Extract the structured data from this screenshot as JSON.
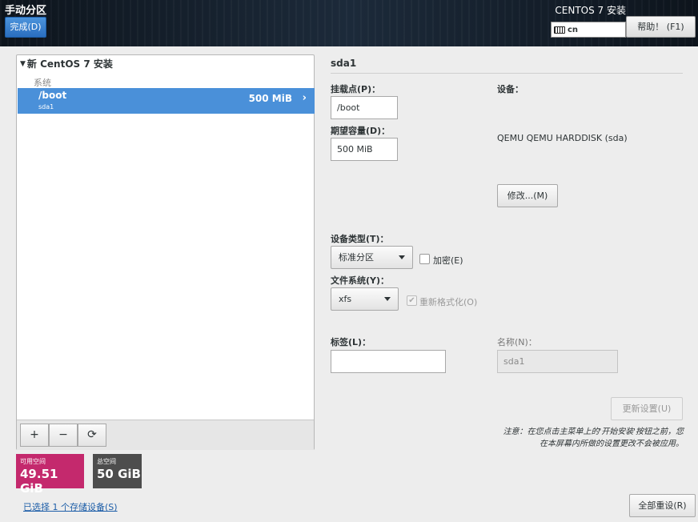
{
  "header": {
    "title": "手动分区",
    "done_label": "完成(D)",
    "product": "CENTOS 7 安装",
    "keyboard_layout": "cn",
    "help_label": "帮助！ (F1)"
  },
  "partitions": {
    "group_title": "新 CentOS 7 安装",
    "section": "系统",
    "items": [
      {
        "mount": "/boot",
        "device": "sda1",
        "size": "500 MiB"
      }
    ]
  },
  "toolbar": {
    "add": "+",
    "remove": "−",
    "refresh": "⟳"
  },
  "space": {
    "available_label": "可用空间",
    "available_value": "49.51 GiB",
    "total_label": "总空间",
    "total_value": "50 GiB",
    "available_color": "#c4296d",
    "total_color": "#4d4d4d"
  },
  "storage_link": "已选择 1 个存储设备(S)",
  "details": {
    "title": "sda1",
    "mount_point_label": "挂载点(P)：",
    "mount_point_value": "/boot",
    "capacity_label": "期望容量(D)：",
    "capacity_value": "500 MiB",
    "device_label": "设备：",
    "device_value": "QEMU QEMU HARDDISK (sda)",
    "modify_label": "修改...(M)",
    "device_type_label": "设备类型(T)：",
    "device_type_value": "标准分区",
    "encrypt_label": "加密(E)",
    "filesystem_label": "文件系统(Y)：",
    "filesystem_value": "xfs",
    "reformat_label": "重新格式化(O)",
    "tag_label": "标签(L)：",
    "tag_value": "",
    "name_label": "名称(N)：",
    "name_value": "sda1",
    "update_label": "更新设置(U)",
    "note_line1": "注意：在您点击主菜单上的'开始安装'按钮之前，您",
    "note_line2": "在本屏幕内所做的设置更改不会被应用。",
    "reset_label": "全部重设(R)"
  }
}
